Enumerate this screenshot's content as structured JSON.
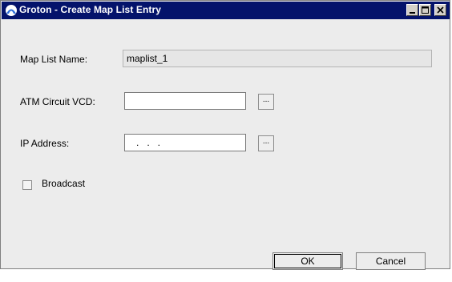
{
  "window": {
    "title": "Groton - Create Map List Entry",
    "icon": "app-icon",
    "controls": {
      "minimize": "minimize-icon",
      "maximize": "maximize-icon",
      "close": "close-icon"
    }
  },
  "form": {
    "map_list_name": {
      "label": "Map List Name:",
      "value": "maplist_1"
    },
    "atm_circuit_vcd": {
      "label": "ATM Circuit VCD:",
      "value": "",
      "browse_label": "..."
    },
    "ip_address": {
      "label": "IP Address:",
      "value": "   .   .   .",
      "browse_label": "..."
    },
    "broadcast": {
      "label": "Broadcast",
      "checked": false
    }
  },
  "buttons": {
    "ok": "OK",
    "cancel": "Cancel"
  },
  "colors": {
    "titlebar": "#04136b",
    "background": "#ececec"
  }
}
